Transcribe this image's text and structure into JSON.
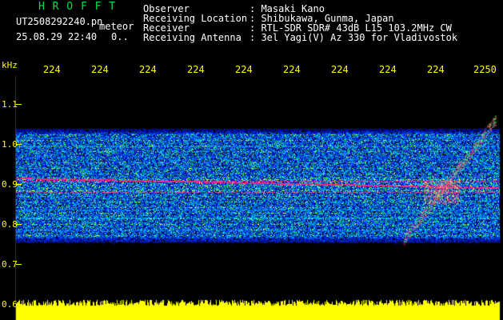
{
  "header": {
    "app_name": "H R O F F T",
    "filename": "UT2508292240.pn",
    "mode": "meteor",
    "datetime": "25.08.29 22:40",
    "status": "0..",
    "fields": [
      {
        "label": "Observer",
        "value": ": Masaki Kano"
      },
      {
        "label": "Receiving Location",
        "value": ": Shibukawa, Gunma, Japan"
      },
      {
        "label": "Receiver",
        "value": ": RTL-SDR SDR# 43dB L15 103.2MHz CW"
      },
      {
        "label": "Receiving Antenna",
        "value": ": 3el Yagi(V) Az 330 for Vladivostok"
      }
    ]
  },
  "axis": {
    "unit": "kHz",
    "time_labels": [
      "224",
      "224",
      "224",
      "224",
      "224",
      "224",
      "224",
      "224",
      "224",
      "2250"
    ],
    "freq_labels": [
      "1.1",
      "1.0",
      "0.9",
      "0.8",
      "0.7",
      "0.6"
    ]
  },
  "colors": {
    "text_white": "#ffffff",
    "title_green": "#00e040",
    "axis_yellow": "#ffff00",
    "meteor_magenta": "#ff2080",
    "background": "#000000"
  }
}
